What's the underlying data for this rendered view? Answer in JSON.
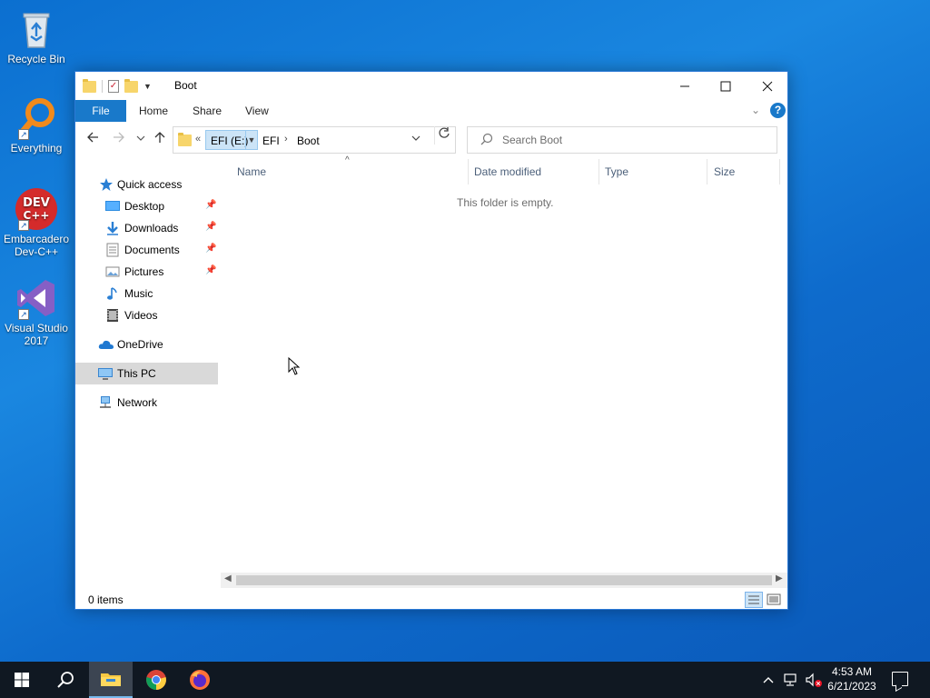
{
  "desktop": {
    "icons": [
      {
        "label": "Recycle Bin",
        "icon": "recycle-bin-icon"
      },
      {
        "label": "Everything",
        "icon": "everything-search-icon"
      },
      {
        "label": "Embarcadero Dev-C++",
        "icon": "devcpp-icon",
        "badge": "DEV C++"
      },
      {
        "label": "Visual Studio 2017",
        "icon": "visual-studio-icon"
      }
    ]
  },
  "window": {
    "title": "Boot",
    "controls": {
      "minimize": "—",
      "maximize": "☐",
      "close": "✕"
    },
    "ribbon": {
      "tabs": [
        "File",
        "Home",
        "Share",
        "View"
      ],
      "help": "?"
    },
    "address": {
      "overflow": "«",
      "crumbs": [
        "EFI (E:)",
        "EFI",
        "Boot"
      ],
      "separator": "›"
    },
    "search": {
      "placeholder": "Search Boot"
    },
    "nav_pane": {
      "quick_access": "Quick access",
      "quick_items": [
        {
          "label": "Desktop",
          "pinned": true
        },
        {
          "label": "Downloads",
          "pinned": true
        },
        {
          "label": "Documents",
          "pinned": true
        },
        {
          "label": "Pictures",
          "pinned": true
        },
        {
          "label": "Music",
          "pinned": false
        },
        {
          "label": "Videos",
          "pinned": false
        }
      ],
      "onedrive": "OneDrive",
      "this_pc": "This PC",
      "network": "Network",
      "selected": "This PC"
    },
    "columns": [
      "Name",
      "Date modified",
      "Type",
      "Size"
    ],
    "empty_message": "This folder is empty.",
    "status": "0 items",
    "accent": "#1979ca"
  },
  "taskbar": {
    "apps": [
      "start-icon",
      "search-icon",
      "file-explorer-icon",
      "chrome-icon",
      "firefox-icon"
    ],
    "active_app": "file-explorer-icon",
    "time": "4:53 AM",
    "date": "6/21/2023"
  }
}
